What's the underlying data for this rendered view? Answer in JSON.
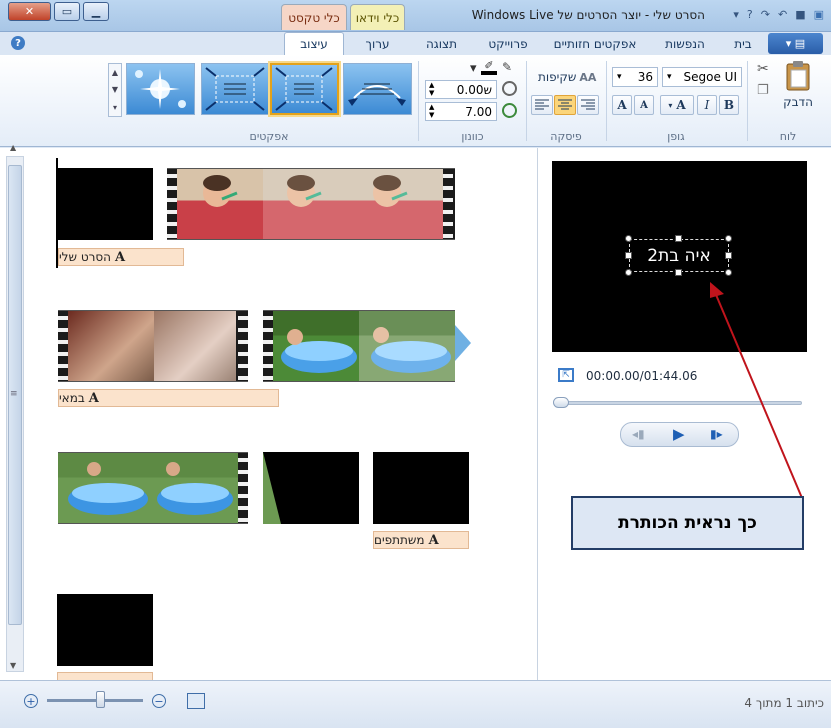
{
  "titlebar": {
    "title": "הסרט שלי - יוצר הסרטים של Windows Live",
    "ctx_tab_video": "כלי וידאו",
    "ctx_tab_text": "כלי טקסט"
  },
  "tabs": {
    "home": "בית",
    "animations": "הנפשות",
    "visual_effects": "אפקטים חזותיים",
    "project": "פרוייקט",
    "view": "תצוגה",
    "edit": "ערוך",
    "format": "עיצוב"
  },
  "ribbon": {
    "clipboard": {
      "paste_label": "הדבק",
      "group": "לוח"
    },
    "font": {
      "family": "Segoe UI",
      "size": "36",
      "group": "גופן",
      "bold": "B",
      "italic": "I",
      "color_letter": "A"
    },
    "paragraph": {
      "transparency_label": "שקיפות",
      "group": "פיסקה"
    },
    "adjust": {
      "start_time": "0.00ש",
      "duration": "7.00",
      "group": "כוונון"
    },
    "effects": {
      "group": "אפקטים"
    }
  },
  "storyboard": {
    "captions": {
      "c1": "הסרט שלי",
      "c2": "במאי",
      "c3": "משתתפים"
    }
  },
  "preview": {
    "title_text": "איה בת2",
    "time": "00:00.00/01:44.06"
  },
  "status": {
    "item_count": "כיתוב 1 מתוך 4"
  },
  "annotation": {
    "callout_text": "כך נראית הכותרת"
  },
  "colors": {
    "ribbon_bg": "#e4edf8",
    "caption_bg": "#fbe3cc",
    "arrow": "#c0141c"
  }
}
